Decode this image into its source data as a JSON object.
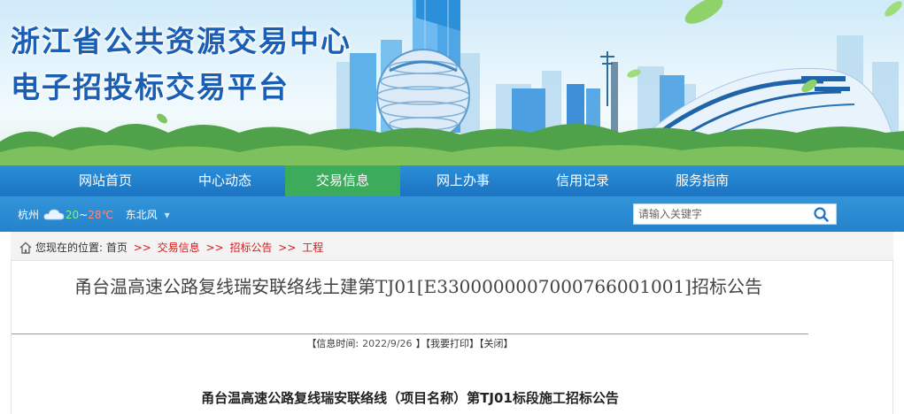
{
  "header": {
    "title_line1": "浙江省公共资源交易中心",
    "title_line2": "电子招投标交易平台"
  },
  "nav": {
    "items": [
      {
        "label": "网站首页"
      },
      {
        "label": "中心动态"
      },
      {
        "label": "交易信息",
        "active": true
      },
      {
        "label": "网上办事"
      },
      {
        "label": "信用记录"
      },
      {
        "label": "服务指南"
      }
    ]
  },
  "weather": {
    "city": "杭州",
    "low": "20",
    "tilde": "~",
    "high": "28℃",
    "wind": "东北风",
    "icon": "cloud-icon"
  },
  "search": {
    "placeholder": "请输入关键字",
    "icon": "search-icon"
  },
  "breadcrumb": {
    "prefix": "您现在的位置:",
    "items": [
      "首页",
      "交易信息",
      "招标公告",
      "工程"
    ],
    "separator": ">>"
  },
  "article": {
    "title": "甬台温高速公路复线瑞安联络线土建第TJ01[E3300000007000766001001]招标公告",
    "meta_open": "【信息时间:",
    "date": "2022/9/26",
    "meta_close": "】",
    "print_label": "【我要打印】",
    "close_label": "【关闭】",
    "heading": "甬台温高速公路复线瑞安联络线（项目名称）第TJ01标段施工招标公告"
  },
  "colors": {
    "brand_blue": "#1b73c2",
    "active_green": "#3dab5c",
    "title_blue": "#1a5fb4",
    "crumb_red": "#d02020"
  }
}
